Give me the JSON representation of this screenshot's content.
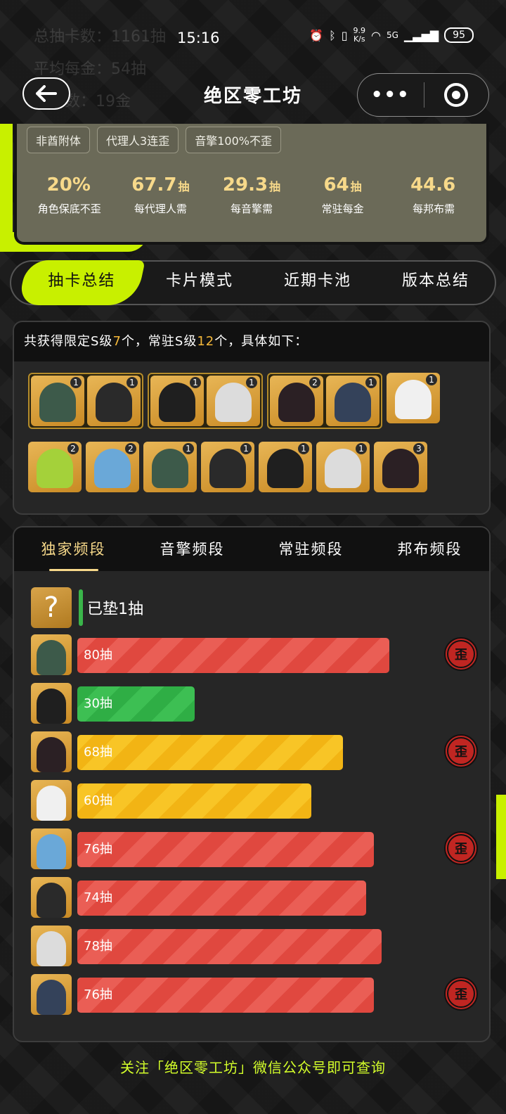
{
  "status_bar": {
    "time": "15:16",
    "network_speed_value": "9.9",
    "network_speed_unit": "K/s",
    "signal": "5G",
    "battery": "95"
  },
  "background_ghost": {
    "line1": "总抽卡数：1161抽",
    "line2": "平均每金：54抽",
    "line3": "歪总数：19金"
  },
  "header": {
    "title": "绝区零工坊",
    "back_icon": "arrow-left-icon",
    "more_label": "•••"
  },
  "summary": {
    "tags": [
      "非酋附体",
      "代理人3连歪",
      "音擎100%不歪"
    ],
    "stats": [
      {
        "value": "20%",
        "unit": "",
        "label": "角色保底不歪"
      },
      {
        "value": "67.7",
        "unit": "抽",
        "label": "每代理人需"
      },
      {
        "value": "29.3",
        "unit": "抽",
        "label": "每音擎需"
      },
      {
        "value": "64",
        "unit": "抽",
        "label": "常驻每金"
      },
      {
        "value": "44.6",
        "unit": "",
        "label": "每邦布需"
      }
    ]
  },
  "main_tabs": [
    "抽卡总结",
    "卡片模式",
    "近期卡池",
    "版本总结"
  ],
  "collection": {
    "text_prefix": "共获得限定S级",
    "limited_count": "7",
    "text_mid": "个，常驻S级",
    "standard_count": "12",
    "text_suffix": "个，具体如下：",
    "row1_groups": [
      [
        {
          "name": "character-avatar",
          "count": "1"
        },
        {
          "name": "wengine-icon",
          "count": "1"
        }
      ],
      [
        {
          "name": "character-avatar",
          "count": "1"
        },
        {
          "name": "wengine-icon",
          "count": "1"
        }
      ],
      [
        {
          "name": "character-avatar",
          "count": "2"
        },
        {
          "name": "wengine-icon",
          "count": "1"
        }
      ]
    ],
    "row1_single": {
      "name": "wengine-icon",
      "count": "1"
    },
    "row2": [
      {
        "name": "character-avatar",
        "count": "2"
      },
      {
        "name": "character-avatar",
        "count": "2"
      },
      {
        "name": "character-avatar",
        "count": "1"
      },
      {
        "name": "bangboo-icon",
        "count": "1"
      },
      {
        "name": "bangboo-icon",
        "count": "1"
      },
      {
        "name": "bangboo-icon",
        "count": "1"
      },
      {
        "name": "bangboo-icon",
        "count": "3"
      }
    ]
  },
  "banner_tabs": [
    "独家频段",
    "音擎频段",
    "常驻频段",
    "邦布频段"
  ],
  "pity": {
    "label": "已垫1抽",
    "icon": "?"
  },
  "pulls": [
    {
      "label": "80抽",
      "pulls": 80,
      "color": "red",
      "lost_5050": true,
      "lost_label": "歪"
    },
    {
      "label": "30抽",
      "pulls": 30,
      "color": "green",
      "lost_5050": false,
      "lost_label": ""
    },
    {
      "label": "68抽",
      "pulls": 68,
      "color": "yellow",
      "lost_5050": true,
      "lost_label": "歪"
    },
    {
      "label": "60抽",
      "pulls": 60,
      "color": "yellow",
      "lost_5050": false,
      "lost_label": ""
    },
    {
      "label": "76抽",
      "pulls": 76,
      "color": "red",
      "lost_5050": true,
      "lost_label": "歪"
    },
    {
      "label": "74抽",
      "pulls": 74,
      "color": "red",
      "lost_5050": false,
      "lost_label": ""
    },
    {
      "label": "78抽",
      "pulls": 78,
      "color": "red",
      "lost_5050": false,
      "lost_label": ""
    },
    {
      "label": "76抽",
      "pulls": 76,
      "color": "red",
      "lost_5050": true,
      "lost_label": "歪"
    }
  ],
  "pull_scale_max": 90,
  "footer": "关注「绝区零工坊」微信公众号即可查询",
  "colors": {
    "accent": "#c8f000",
    "gold": "#f7d98a",
    "red": "#e0483f",
    "green": "#2fae45",
    "yellow": "#f2b414"
  }
}
